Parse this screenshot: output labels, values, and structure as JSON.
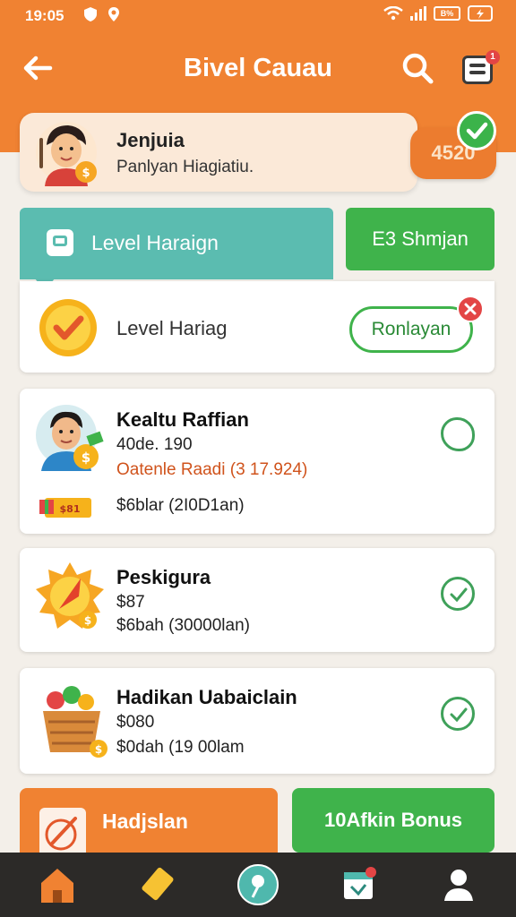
{
  "status_bar": {
    "time": "19:05",
    "battery": "B%"
  },
  "app_bar": {
    "title": "Bivel Cauau",
    "notification_count": "1"
  },
  "profile": {
    "name": "Jenjuia",
    "subtitle": "Panlyan Hiagiatiu.",
    "coins": "4520"
  },
  "level_tab": {
    "label": "Level Haraign"
  },
  "claim_button": {
    "label": "E3 Shmjan"
  },
  "level_card": {
    "label": "Level Hariag",
    "action_label": "Ronlayan"
  },
  "tasks": [
    {
      "title": "Kealtu Raffian",
      "line1": "40de. 190",
      "line2": "Oatenle Raadi (3 17.924)",
      "line3": "$6blar (2I0D1an)"
    },
    {
      "title": "Peskigura",
      "line1": "$87",
      "line2": "$6bah (30000lan)"
    },
    {
      "title": "Hadikan Uabaiclain",
      "line1": "$080",
      "line2": "$0dah (19 00lam"
    }
  ],
  "task_badge": "$81",
  "actions": {
    "left_label": "Hadjslan",
    "right_label": "10Afkin Bonus"
  },
  "bottom_nav": [
    "home-icon",
    "ticket-icon",
    "wheel-icon",
    "calendar-icon",
    "profile-icon"
  ],
  "colors": {
    "orange": "#f08232",
    "green": "#3fb34b",
    "teal": "#5bbcb0",
    "nav": "#2c2a28"
  }
}
